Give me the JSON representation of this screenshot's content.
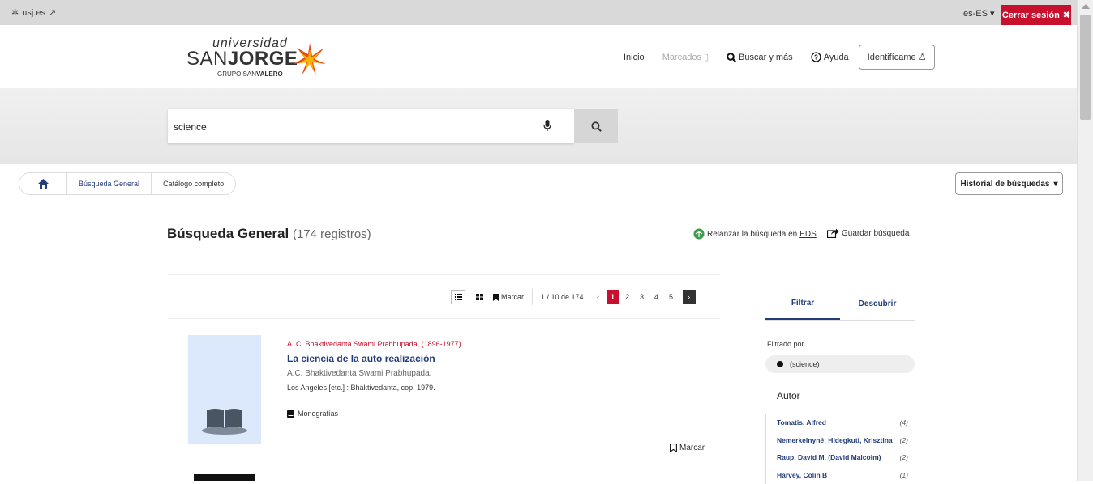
{
  "topbar": {
    "site_link": "usj.es",
    "language": "es-ES",
    "logout_label": "Cerrar sesión"
  },
  "brand": {
    "universidad": "universidad",
    "san": "SAN",
    "jorge": "JORGE",
    "grupo": "GRUPO SAN",
    "grupo_bold": "VALERO"
  },
  "nav": {
    "inicio": "Inicio",
    "marcados": "Marcados",
    "buscar": "Buscar y más",
    "ayuda": "Ayuda",
    "identificame": "Identifícame"
  },
  "search": {
    "query": "science"
  },
  "breadcrumb": {
    "items": [
      "Búsqueda General",
      "Catálogo completo"
    ]
  },
  "historial_label": "Historial de búsquedas",
  "results_header": {
    "title": "Búsqueda General",
    "count": "(174 registros)",
    "relanzar": "Relanzar la búsqueda en ",
    "relanzar_link": "EDS",
    "guardar": "Guardar búsqueda"
  },
  "toolbar": {
    "marcar": "Marcar",
    "range": "1 / 10 de 174",
    "prev": "‹",
    "pages": [
      "1",
      "2",
      "3",
      "4",
      "5"
    ],
    "next": "›"
  },
  "result1": {
    "author": "A. C. Bhaktivedanta Swami Prabhupada, (1896-1977)",
    "title": "La ciencia de la auto realización",
    "responsibility": "A.C. Bhaktivedanta Swami Prabhupada.",
    "publication": "Los Angeles [etc.] : Bhaktivedanta, cop. 1979.",
    "type": "Monografías",
    "marcar": "Marcar"
  },
  "sidebar": {
    "tab_filtrar": "Filtrar",
    "tab_descubrir": "Descubrir",
    "filtrado_por": "Filtrado por",
    "filter_pill": "(science)",
    "autor_heading": "Autor",
    "facets": [
      {
        "name": "Tomatis, Alfred",
        "count": "(4)"
      },
      {
        "name": "Nemerkelnyné; Hidegkuti, Krisztina",
        "count": "(2)"
      },
      {
        "name": "Raup, David M. (David Malcolm)",
        "count": "(2)"
      },
      {
        "name": "Harvey, Colin B",
        "count": "(1)"
      }
    ]
  },
  "colors": {
    "brand_red": "#c8102e",
    "link_blue": "#223d7a"
  }
}
